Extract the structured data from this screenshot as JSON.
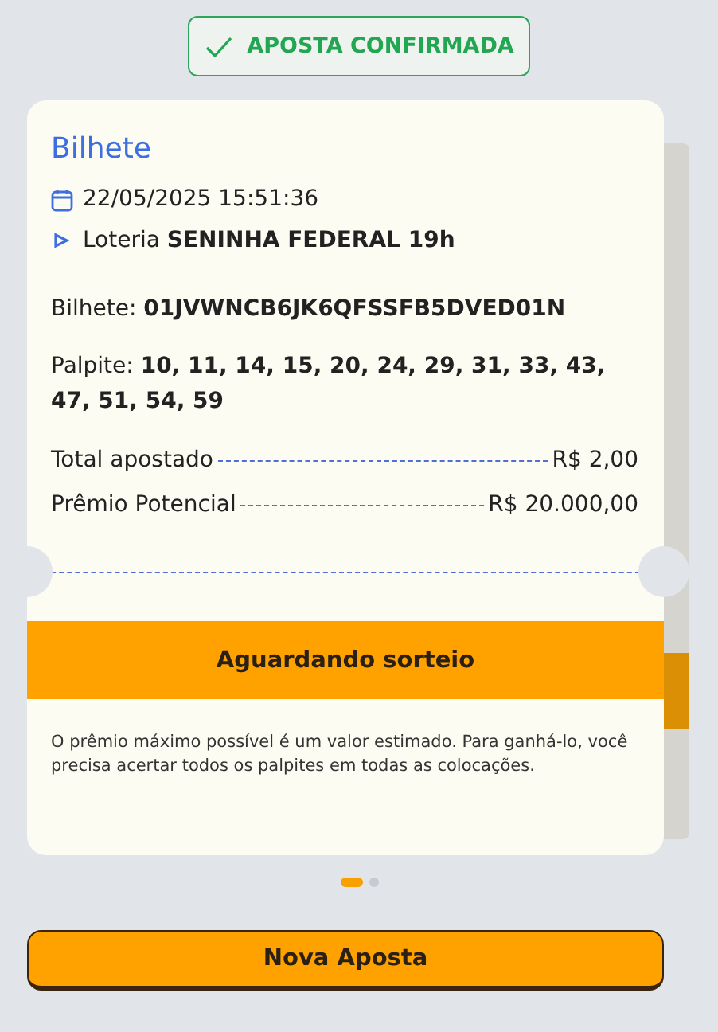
{
  "status_badge": {
    "label": "APOSTA CONFIRMADA"
  },
  "ticket": {
    "title": "Bilhete",
    "date": "22/05/2025 15:51:36",
    "lottery": "Loteria **SENINHA FEDERAL 19h**",
    "ticket_code": "Bilhete: **01JVWNCB6JK6QFSSFB5DVED01N**",
    "guess": "Palpite: **10, 11, 14, 15, 20, 24, 29, 31, 33, 43, 47, 51, 54, 59**",
    "totals": [
      {
        "label": "Total apostado",
        "value": "R$ 2,00"
      },
      {
        "label": "Prêmio Potencial",
        "value": "R$ 20.000,00"
      }
    ],
    "status": "Aguardando sorteio",
    "note": "O prêmio máximo possível é um valor estimado. Para ganhá-lo, você precisa acertar todos os palpites em todas as colocações."
  },
  "pager": [
    {
      "selected": true
    },
    {
      "selected": false
    }
  ],
  "buttons": [
    {
      "label": "Nova Aposta"
    }
  ]
}
